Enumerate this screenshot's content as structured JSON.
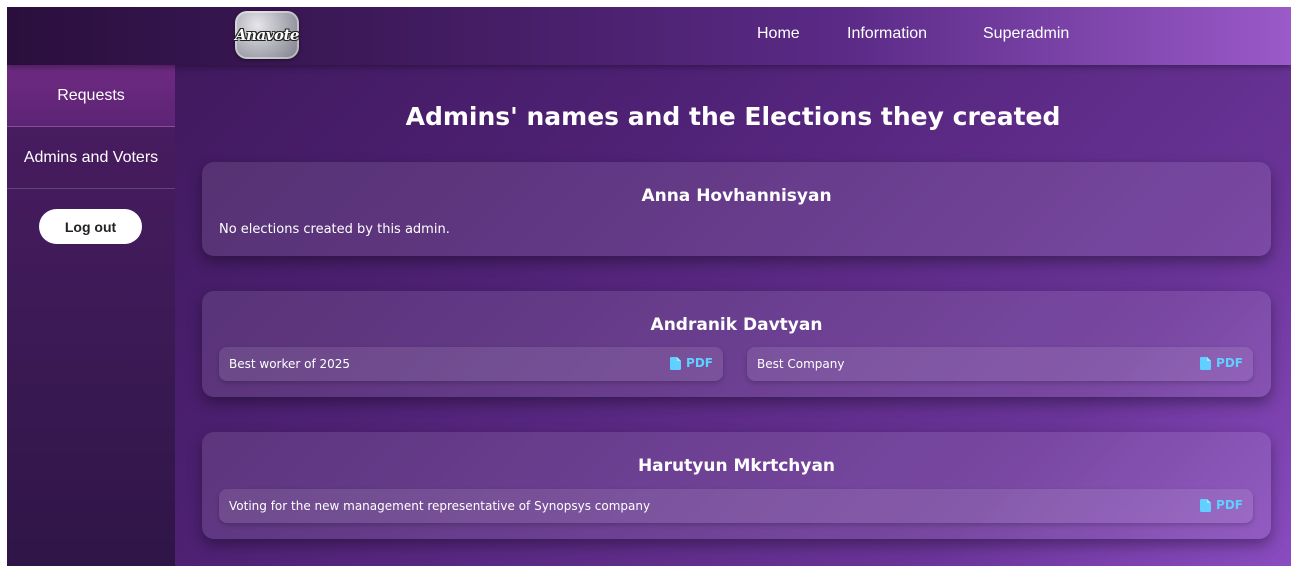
{
  "header": {
    "logo_text": "Anavote",
    "nav": [
      {
        "label": "Home"
      },
      {
        "label": "Information"
      },
      {
        "label": "Superadmin"
      }
    ]
  },
  "sidebar": {
    "items": [
      {
        "label": "Requests",
        "active": true
      },
      {
        "label": "Admins and Voters",
        "active": false
      }
    ],
    "logout_label": "Log out"
  },
  "main": {
    "title": "Admins' names and the Elections they created",
    "admins": [
      {
        "name": "Anna Hovhannisyan",
        "empty_message": "No elections created by this admin.",
        "elections": []
      },
      {
        "name": "Andranik Davtyan",
        "elections": [
          {
            "title": "Best worker of 2025",
            "pdf_label": "PDF"
          },
          {
            "title": "Best Company",
            "pdf_label": "PDF"
          }
        ]
      },
      {
        "name": "Harutyun Mkrtchyan",
        "elections": [
          {
            "title": "Voting for the new management representative of Synopsys company",
            "pdf_label": "PDF"
          }
        ]
      }
    ]
  },
  "colors": {
    "accent_link": "#5fd0ff",
    "header_start": "#2a0f3d",
    "header_end": "#9a5ac8",
    "sidebar_active": "#6e2a82"
  }
}
